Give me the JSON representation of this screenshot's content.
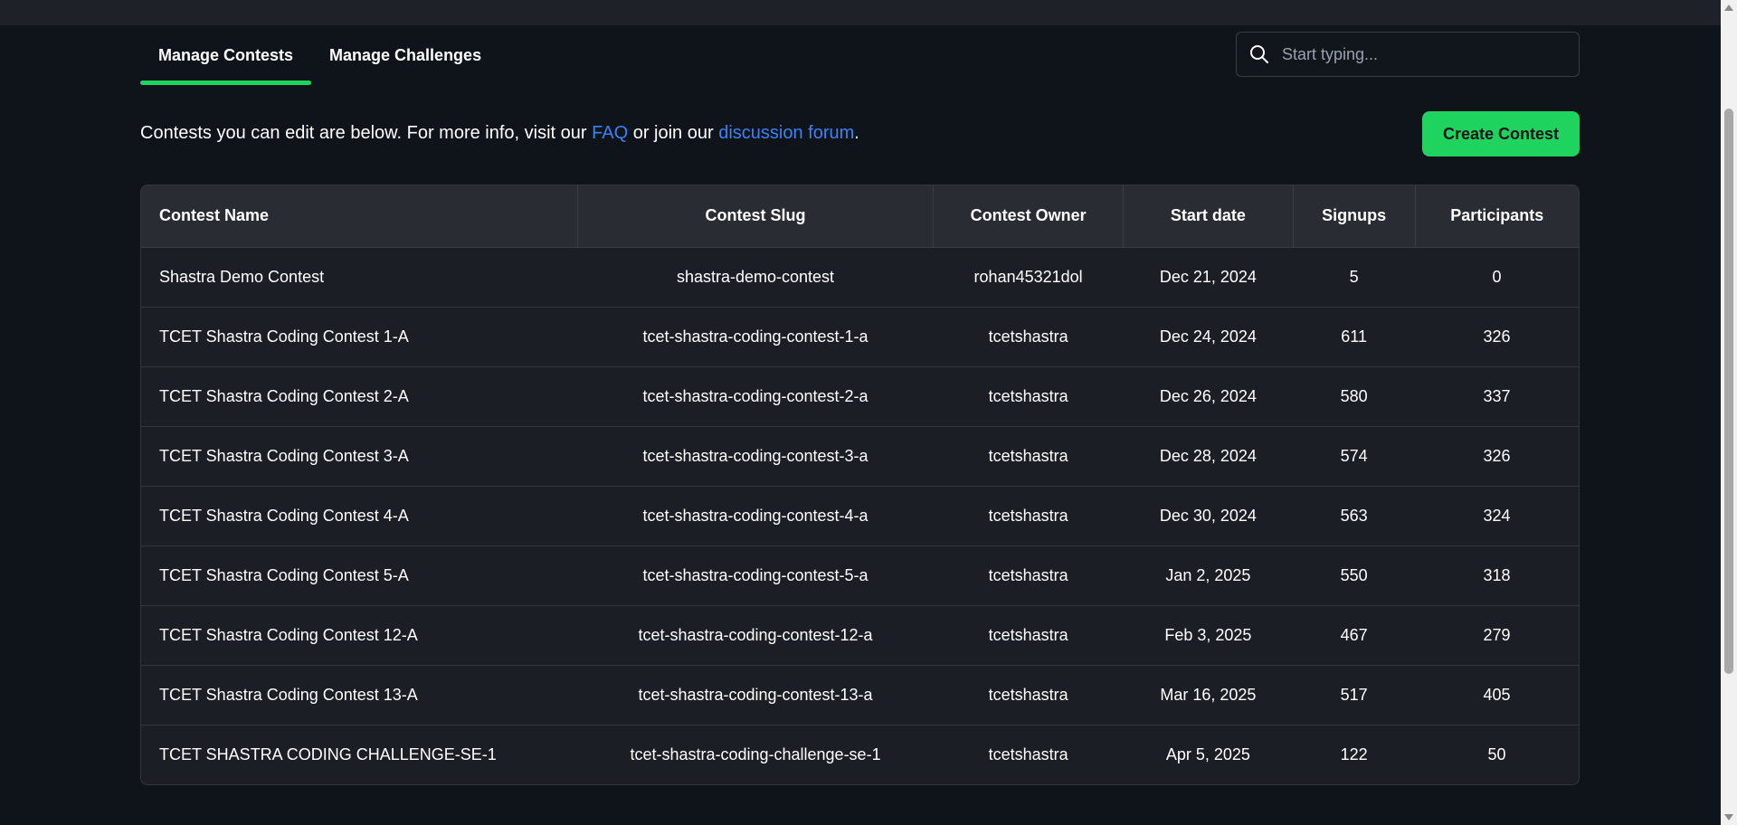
{
  "tabs": [
    {
      "label": "Manage Contests",
      "active": true
    },
    {
      "label": "Manage Challenges",
      "active": false
    }
  ],
  "search": {
    "placeholder": "Start typing..."
  },
  "intro": {
    "text_before": "Contests you can edit are below. For more info, visit our ",
    "faq_link": "FAQ",
    "text_middle": " or join our ",
    "forum_link": "discussion forum",
    "text_after": "."
  },
  "create_button": "Create Contest",
  "table": {
    "headers": [
      "Contest Name",
      "Contest Slug",
      "Contest Owner",
      "Start date",
      "Signups",
      "Participants"
    ],
    "rows": [
      [
        "Shastra Demo Contest",
        "shastra-demo-contest",
        "rohan45321dol",
        "Dec 21, 2024",
        "5",
        "0"
      ],
      [
        "TCET Shastra Coding Contest 1-A",
        "tcet-shastra-coding-contest-1-a",
        "tcetshastra",
        "Dec 24, 2024",
        "611",
        "326"
      ],
      [
        "TCET Shastra Coding Contest 2-A",
        "tcet-shastra-coding-contest-2-a",
        "tcetshastra",
        "Dec 26, 2024",
        "580",
        "337"
      ],
      [
        "TCET Shastra Coding Contest 3-A",
        "tcet-shastra-coding-contest-3-a",
        "tcetshastra",
        "Dec 28, 2024",
        "574",
        "326"
      ],
      [
        "TCET Shastra Coding Contest 4-A",
        "tcet-shastra-coding-contest-4-a",
        "tcetshastra",
        "Dec 30, 2024",
        "563",
        "324"
      ],
      [
        "TCET Shastra Coding Contest 5-A",
        "tcet-shastra-coding-contest-5-a",
        "tcetshastra",
        "Jan 2, 2025",
        "550",
        "318"
      ],
      [
        "TCET Shastra Coding Contest 12-A",
        "tcet-shastra-coding-contest-12-a",
        "tcetshastra",
        "Feb 3, 2025",
        "467",
        "279"
      ],
      [
        "TCET Shastra Coding Contest 13-A",
        "tcet-shastra-coding-contest-13-a",
        "tcetshastra",
        "Mar 16, 2025",
        "517",
        "405"
      ],
      [
        "TCET SHASTRA CODING CHALLENGE-SE-1",
        "tcet-shastra-coding-challenge-se-1",
        "tcetshastra",
        "Apr 5, 2025",
        "122",
        "50"
      ]
    ]
  },
  "colors": {
    "accent": "#1fd35f",
    "link": "#3b82f6",
    "background": "#0f131a"
  },
  "icons": {
    "search": "search-icon"
  }
}
